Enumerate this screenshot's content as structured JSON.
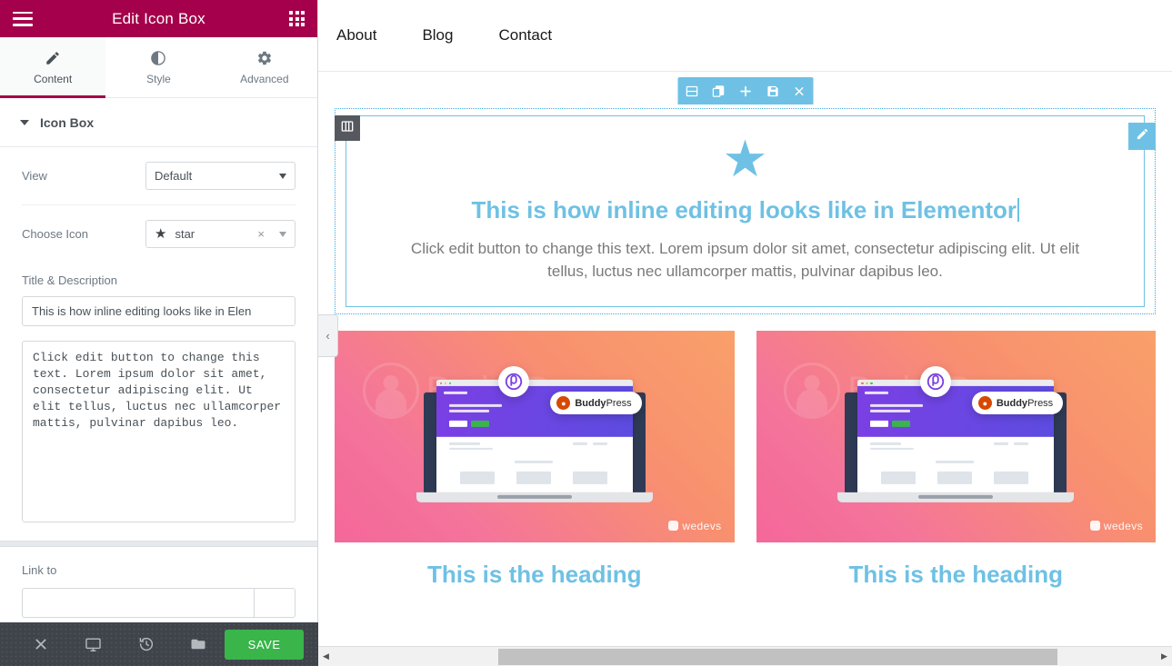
{
  "panel": {
    "header": {
      "title": "Edit Icon Box",
      "menu_icon": "hamburger-icon",
      "apps_icon": "grid-icon"
    },
    "tabs": [
      {
        "label": "Content",
        "icon": "pencil-icon",
        "active": true
      },
      {
        "label": "Style",
        "icon": "contrast-icon",
        "active": false
      },
      {
        "label": "Advanced",
        "icon": "gear-icon",
        "active": false
      }
    ],
    "section": {
      "label": "Icon Box",
      "expanded": true
    },
    "controls": {
      "view_label": "View",
      "view_value": "Default",
      "choose_icon_label": "Choose Icon",
      "choose_icon_value": "star",
      "choose_icon_glyph": "★",
      "clear_glyph": "×"
    },
    "title_desc": {
      "group_label": "Title & Description",
      "title_value": "This is how inline editing looks like in Elen",
      "description_value": "Click edit button to change this text. Lorem ipsum dolor sit amet, consectetur adipiscing elit. Ut elit tellus, luctus nec ullamcorper mattis, pulvinar dapibus leo."
    },
    "link": {
      "label": "Link to",
      "value": "",
      "placeholder": ""
    },
    "footer": {
      "settings_icon": "close-x-icon",
      "responsive_icon": "monitor-icon",
      "history_icon": "history-clock-icon",
      "navigator_icon": "folder-icon",
      "save_label": "SAVE",
      "save_color": "#39b54a"
    },
    "collapse_handle_glyph": "‹",
    "brand_color": "#a4004b"
  },
  "canvas": {
    "nav": [
      {
        "label": "About"
      },
      {
        "label": "Blog"
      },
      {
        "label": "Contact"
      }
    ],
    "element_toolbar": [
      {
        "icon": "section-columns-icon"
      },
      {
        "icon": "duplicate-icon"
      },
      {
        "icon": "add-plus-icon"
      },
      {
        "icon": "save-floppy-icon"
      },
      {
        "icon": "close-x-icon"
      }
    ],
    "column_handle_icon": "column-layout-icon",
    "edit_pencil_icon": "pencil-edit-icon",
    "icon_box": {
      "icon_glyph": "★",
      "icon_color": "#6ec1e4",
      "title": "This is how inline editing looks like in Elementor",
      "description": "Click edit button to change this text. Lorem ipsum dolor sit amet, consectetur adipiscing elit. Ut elit tellus, luctus nec ullamcorper mattis, pulvinar dapibus leo.",
      "title_color": "#6ec1e4",
      "desc_color": "#7a7a7a",
      "editing_cursor": true
    },
    "cards": [
      {
        "image_alt": "BuddyPress promotional banner",
        "watermark_text_light": "Buddy",
        "watermark_text_bold": "Press",
        "badge_text_bold": "Buddy",
        "badge_text_light": "Press",
        "brand_footer": "wedevs",
        "heading": "This is the heading"
      },
      {
        "image_alt": "BuddyPress promotional banner",
        "watermark_text_light": "Buddy",
        "watermark_text_bold": "Press",
        "badge_text_bold": "Buddy",
        "badge_text_light": "Press",
        "brand_footer": "wedevs",
        "heading": "This is the heading"
      }
    ],
    "scrollbar": {
      "left_arrow": "◀",
      "right_arrow": "▶"
    }
  }
}
